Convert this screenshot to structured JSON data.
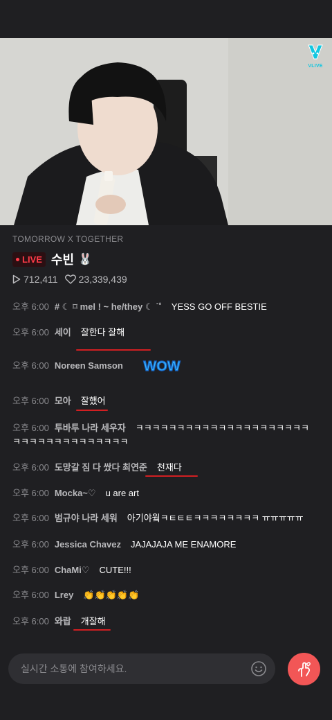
{
  "video": {
    "logo_text": "VLIVE"
  },
  "stream": {
    "channel": "TOMORROW X TOGETHER",
    "live_label": "LIVE",
    "title": "수빈",
    "title_emoji": "🐰",
    "views": "712,411",
    "hearts": "23,339,439"
  },
  "chat": {
    "messages": [
      {
        "time": "오후 6:00",
        "user": "# ☾ ⌑ mel ! ~ he/they ☾ ˙˚",
        "text": "YESS GO OFF BESTIE"
      },
      {
        "time": "오후 6:00",
        "user": "세이",
        "text": "잘한다 잘해"
      },
      {
        "time": "오후 6:00",
        "user": "Noreen Samson",
        "text": ""
      },
      {
        "time": "오후 6:00",
        "user": "모아",
        "text": "잘했어"
      },
      {
        "time": "오후 6:00",
        "user": "투바투 나라 세우자",
        "text": "ㅋㅋㅋㅋㅋㅋㅋㅋㅋㅋㅋㅋㅋㅋㅋㅋㅋㅋㅋㅋㅋㅋㅋㅋㅋㅋㅋㅋㅋㅋㅋㅋㅋㅋㅋ"
      },
      {
        "time": "오후 6:00",
        "user": "도망갈 짐 다 쌌다 최연준",
        "text": "천재다"
      },
      {
        "time": "오후 6:00",
        "user": "Mocka~♡",
        "text": "u are art"
      },
      {
        "time": "오후 6:00",
        "user": "범규야 나라 세워",
        "text": "아기야웤ㅋㅌㅌㅌㅋㅋㅋㅋㅋㅋㅋㅋ ㅠㅠㅠㅠㅠ"
      },
      {
        "time": "오후 6:00",
        "user": "Jessica Chavez",
        "text": "JAJAJAJA ME ENAMORE"
      },
      {
        "time": "오후 6:00",
        "user": "ChaMi♡",
        "text": "CUTE!!!"
      },
      {
        "time": "오후 6:00",
        "user": "Lrey",
        "text": "👏👏👏👏👏"
      },
      {
        "time": "오후 6:00",
        "user": "와랍",
        "text": "개잘해"
      }
    ],
    "sticker_text": "WOW"
  },
  "input": {
    "placeholder": "실시간 소통에 참여하세요."
  },
  "icons": {
    "emoji": "smile-icon",
    "heart_button": "finger-heart-icon",
    "views": "play-icon",
    "hearts": "heart-icon"
  },
  "colors": {
    "accent": "#f25656",
    "live_red": "#ff3b48",
    "vlive_cyan": "#13c7e0"
  }
}
